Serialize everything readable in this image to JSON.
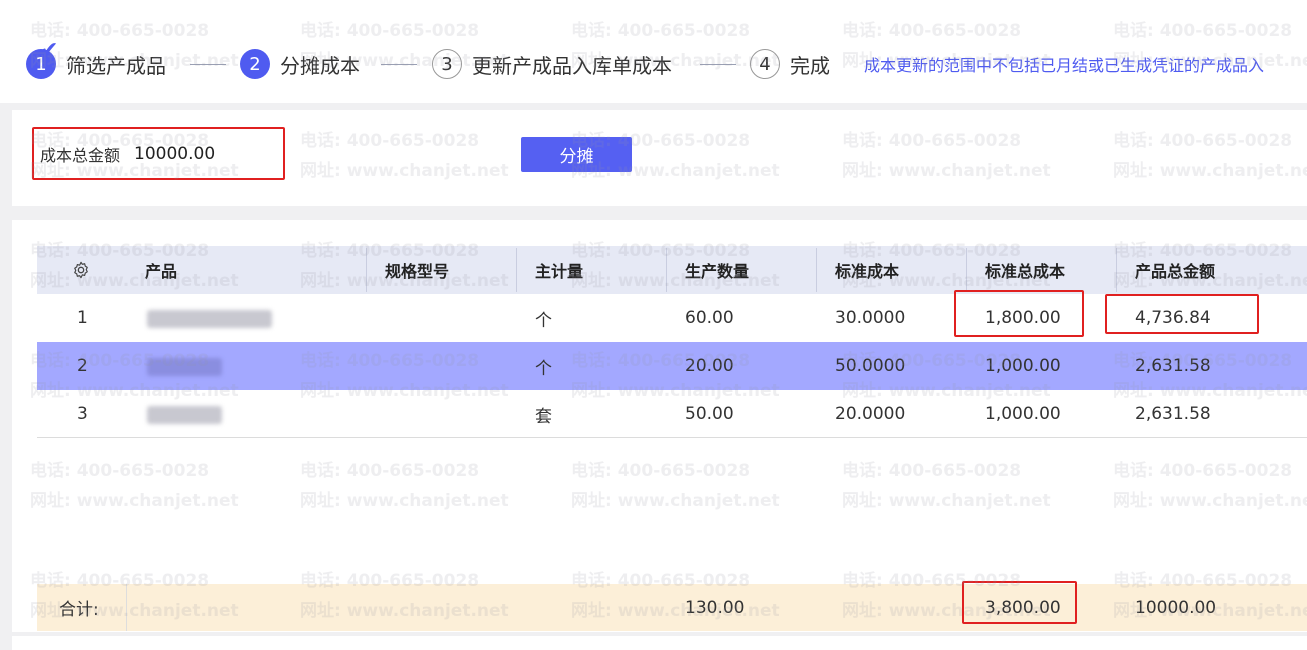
{
  "steps": [
    {
      "num": "1",
      "label": "筛选产成品"
    },
    {
      "num": "2",
      "label": "分摊成本"
    },
    {
      "num": "3",
      "label": "更新产成品入库单成本"
    },
    {
      "num": "4",
      "label": "完成"
    }
  ],
  "notice": "成本更新的范围中不包括已月结或已生成凭证的产成品入",
  "allocation": {
    "label": "成本总金额",
    "value": "10000.00",
    "button": "分摊"
  },
  "table": {
    "headers": [
      "产品",
      "规格型号",
      "主计量",
      "生产数量",
      "标准成本",
      "标准总成本",
      "产品总金额"
    ],
    "rows": [
      {
        "idx": "1",
        "unit": "个",
        "qty": "60.00",
        "std_cost": "30.0000",
        "std_total": "1,800.00",
        "amount": "4,736.84"
      },
      {
        "idx": "2",
        "unit": "个",
        "qty": "20.00",
        "std_cost": "50.0000",
        "std_total": "1,000.00",
        "amount": "2,631.58"
      },
      {
        "idx": "3",
        "unit": "套",
        "qty": "50.00",
        "std_cost": "20.0000",
        "std_total": "1,000.00",
        "amount": "2,631.58"
      }
    ],
    "footer": {
      "label": "合计:",
      "qty": "130.00",
      "std_total": "3,800.00",
      "amount": "10000.00"
    }
  },
  "watermark": {
    "phone": "电话: 400-665-0028",
    "site": "网址: www.chanjet.net"
  },
  "colors": {
    "accent": "#4f5bf0",
    "highlight": "#e02020",
    "selected_row": "#a3a8ff",
    "footer": "#fcefd8"
  }
}
